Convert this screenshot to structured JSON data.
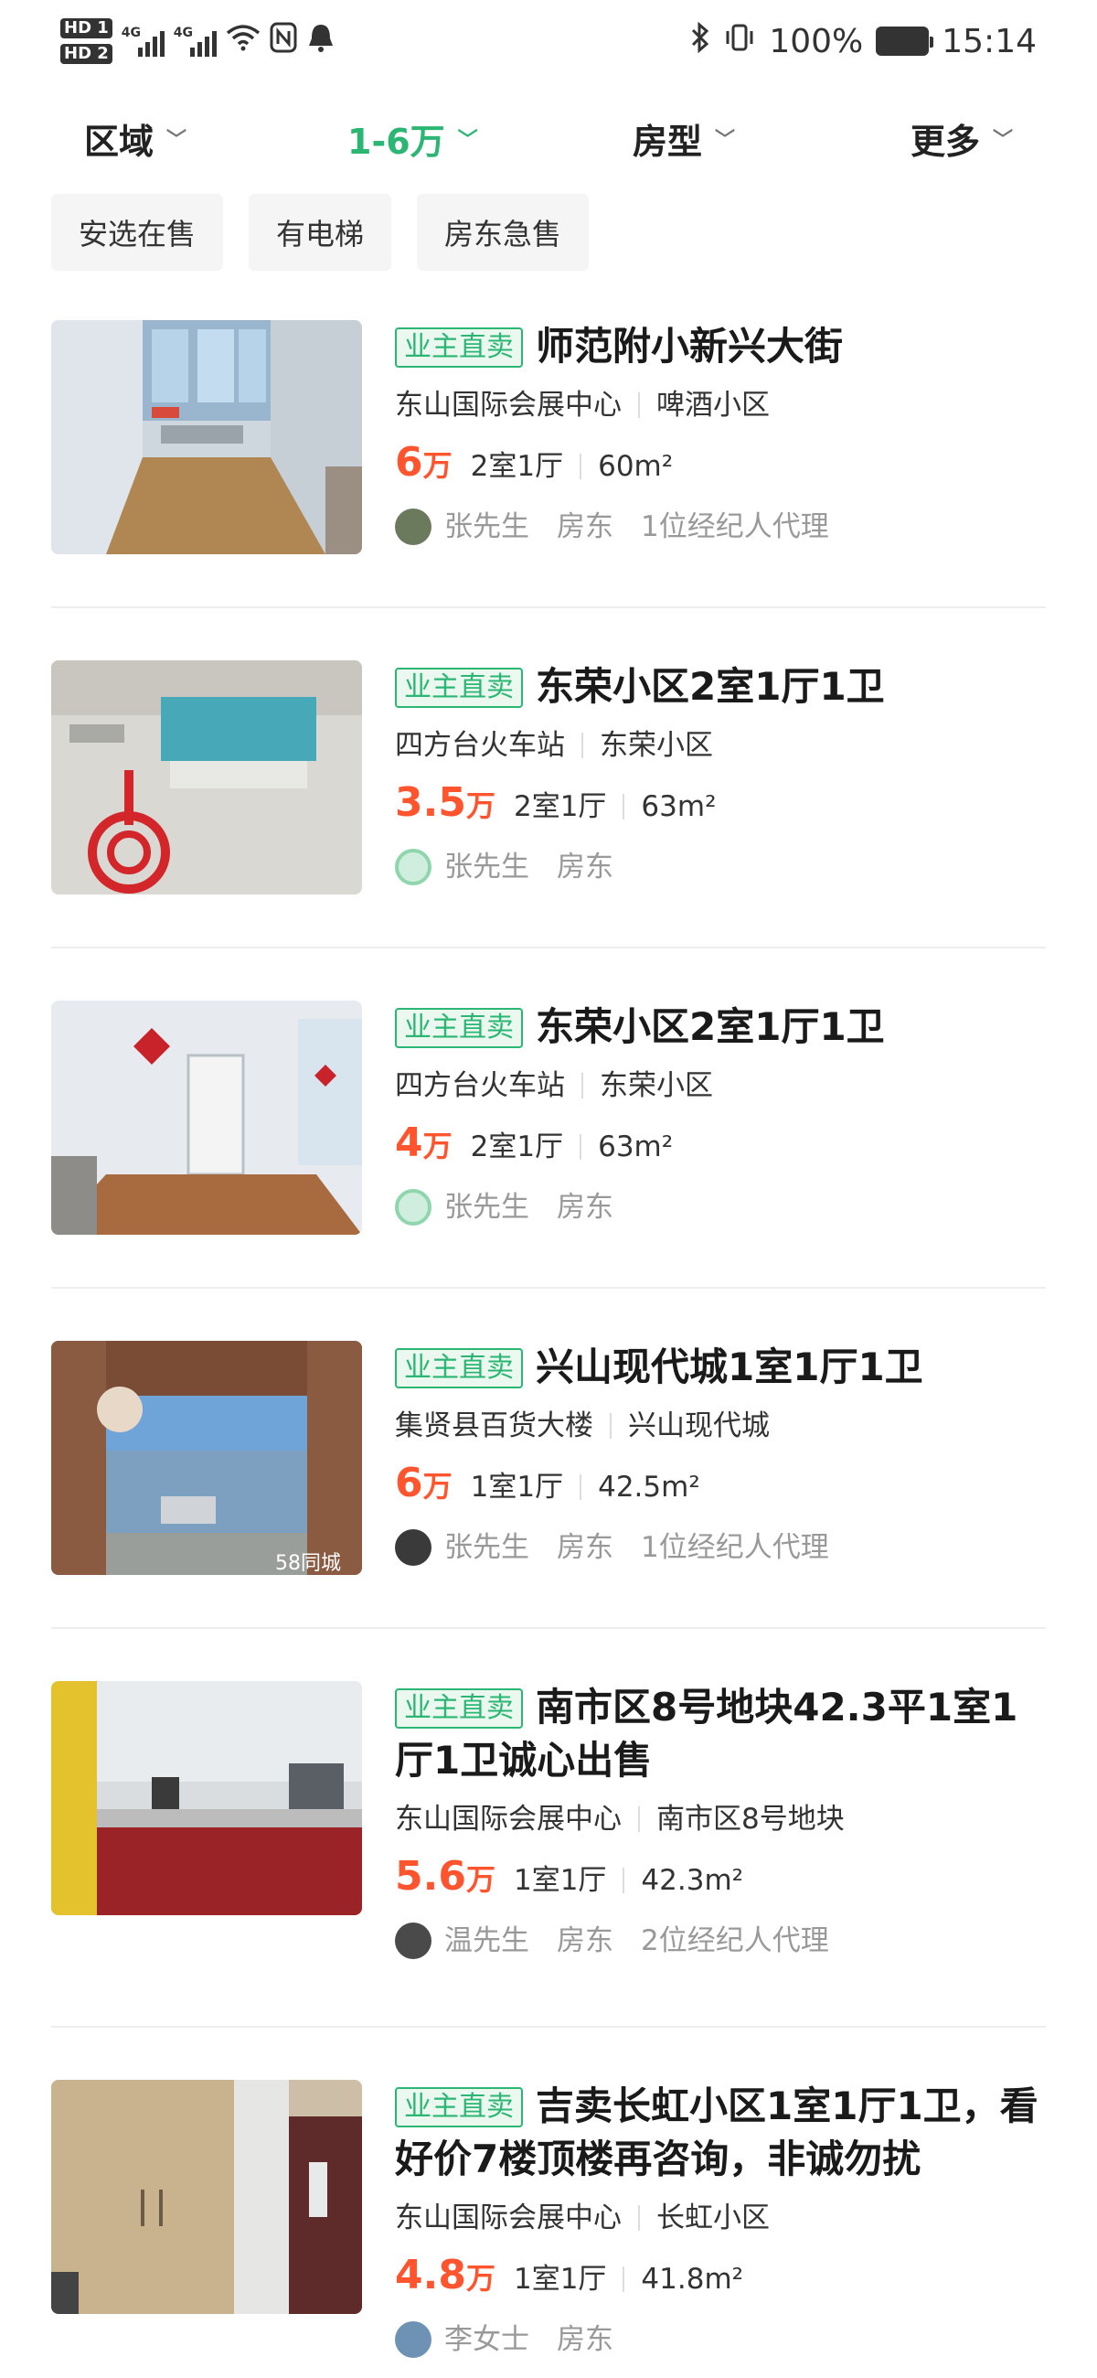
{
  "status_bar": {
    "hd1": "HD 1",
    "hd2": "HD 2",
    "net1": "4G",
    "net2": "4G",
    "battery": "100%",
    "time": "15:14"
  },
  "filters": [
    {
      "label": "区域",
      "active": false
    },
    {
      "label": "1-6万",
      "active": true
    },
    {
      "label": "房型",
      "active": false
    },
    {
      "label": "更多",
      "active": false
    }
  ],
  "tags": [
    "安选在售",
    "有电梯",
    "房东急售"
  ],
  "listings": [
    {
      "badge": "业主直卖",
      "title": "师范附小新兴大街",
      "area": "东山国际会展中心",
      "community": "啤酒小区",
      "price": "6",
      "price_unit": "万",
      "layout": "2室1厅",
      "size": "60m²",
      "agent": "张先生",
      "role": "房东",
      "proxy": "1位经纪人代理"
    },
    {
      "badge": "业主直卖",
      "title": "东荣小区2室1厅1卫",
      "area": "四方台火车站",
      "community": "东荣小区",
      "price": "3.5",
      "price_unit": "万",
      "layout": "2室1厅",
      "size": "63m²",
      "agent": "张先生",
      "role": "房东",
      "proxy": ""
    },
    {
      "badge": "业主直卖",
      "title": "东荣小区2室1厅1卫",
      "area": "四方台火车站",
      "community": "东荣小区",
      "price": "4",
      "price_unit": "万",
      "layout": "2室1厅",
      "size": "63m²",
      "agent": "张先生",
      "role": "房东",
      "proxy": ""
    },
    {
      "badge": "业主直卖",
      "title": "兴山现代城1室1厅1卫",
      "area": "集贤县百货大楼",
      "community": "兴山现代城",
      "price": "6",
      "price_unit": "万",
      "layout": "1室1厅",
      "size": "42.5m²",
      "agent": "张先生",
      "role": "房东",
      "proxy": "1位经纪人代理"
    },
    {
      "badge": "业主直卖",
      "title": "南市区8号地块42.3平1室1厅1卫诚心出售",
      "area": "东山国际会展中心",
      "community": "南市区8号地块",
      "price": "5.6",
      "price_unit": "万",
      "layout": "1室1厅",
      "size": "42.3m²",
      "agent": "温先生",
      "role": "房东",
      "proxy": "2位经纪人代理"
    },
    {
      "badge": "业主直卖",
      "title": "吉卖长虹小区1室1厅1卫，看好价7楼顶楼再咨询，非诚勿扰",
      "area": "东山国际会展中心",
      "community": "长虹小区",
      "price": "4.8",
      "price_unit": "万",
      "layout": "1室1厅",
      "size": "41.8m²",
      "agent": "李女士",
      "role": "房东",
      "proxy": ""
    }
  ],
  "image_watermark": "58同城"
}
